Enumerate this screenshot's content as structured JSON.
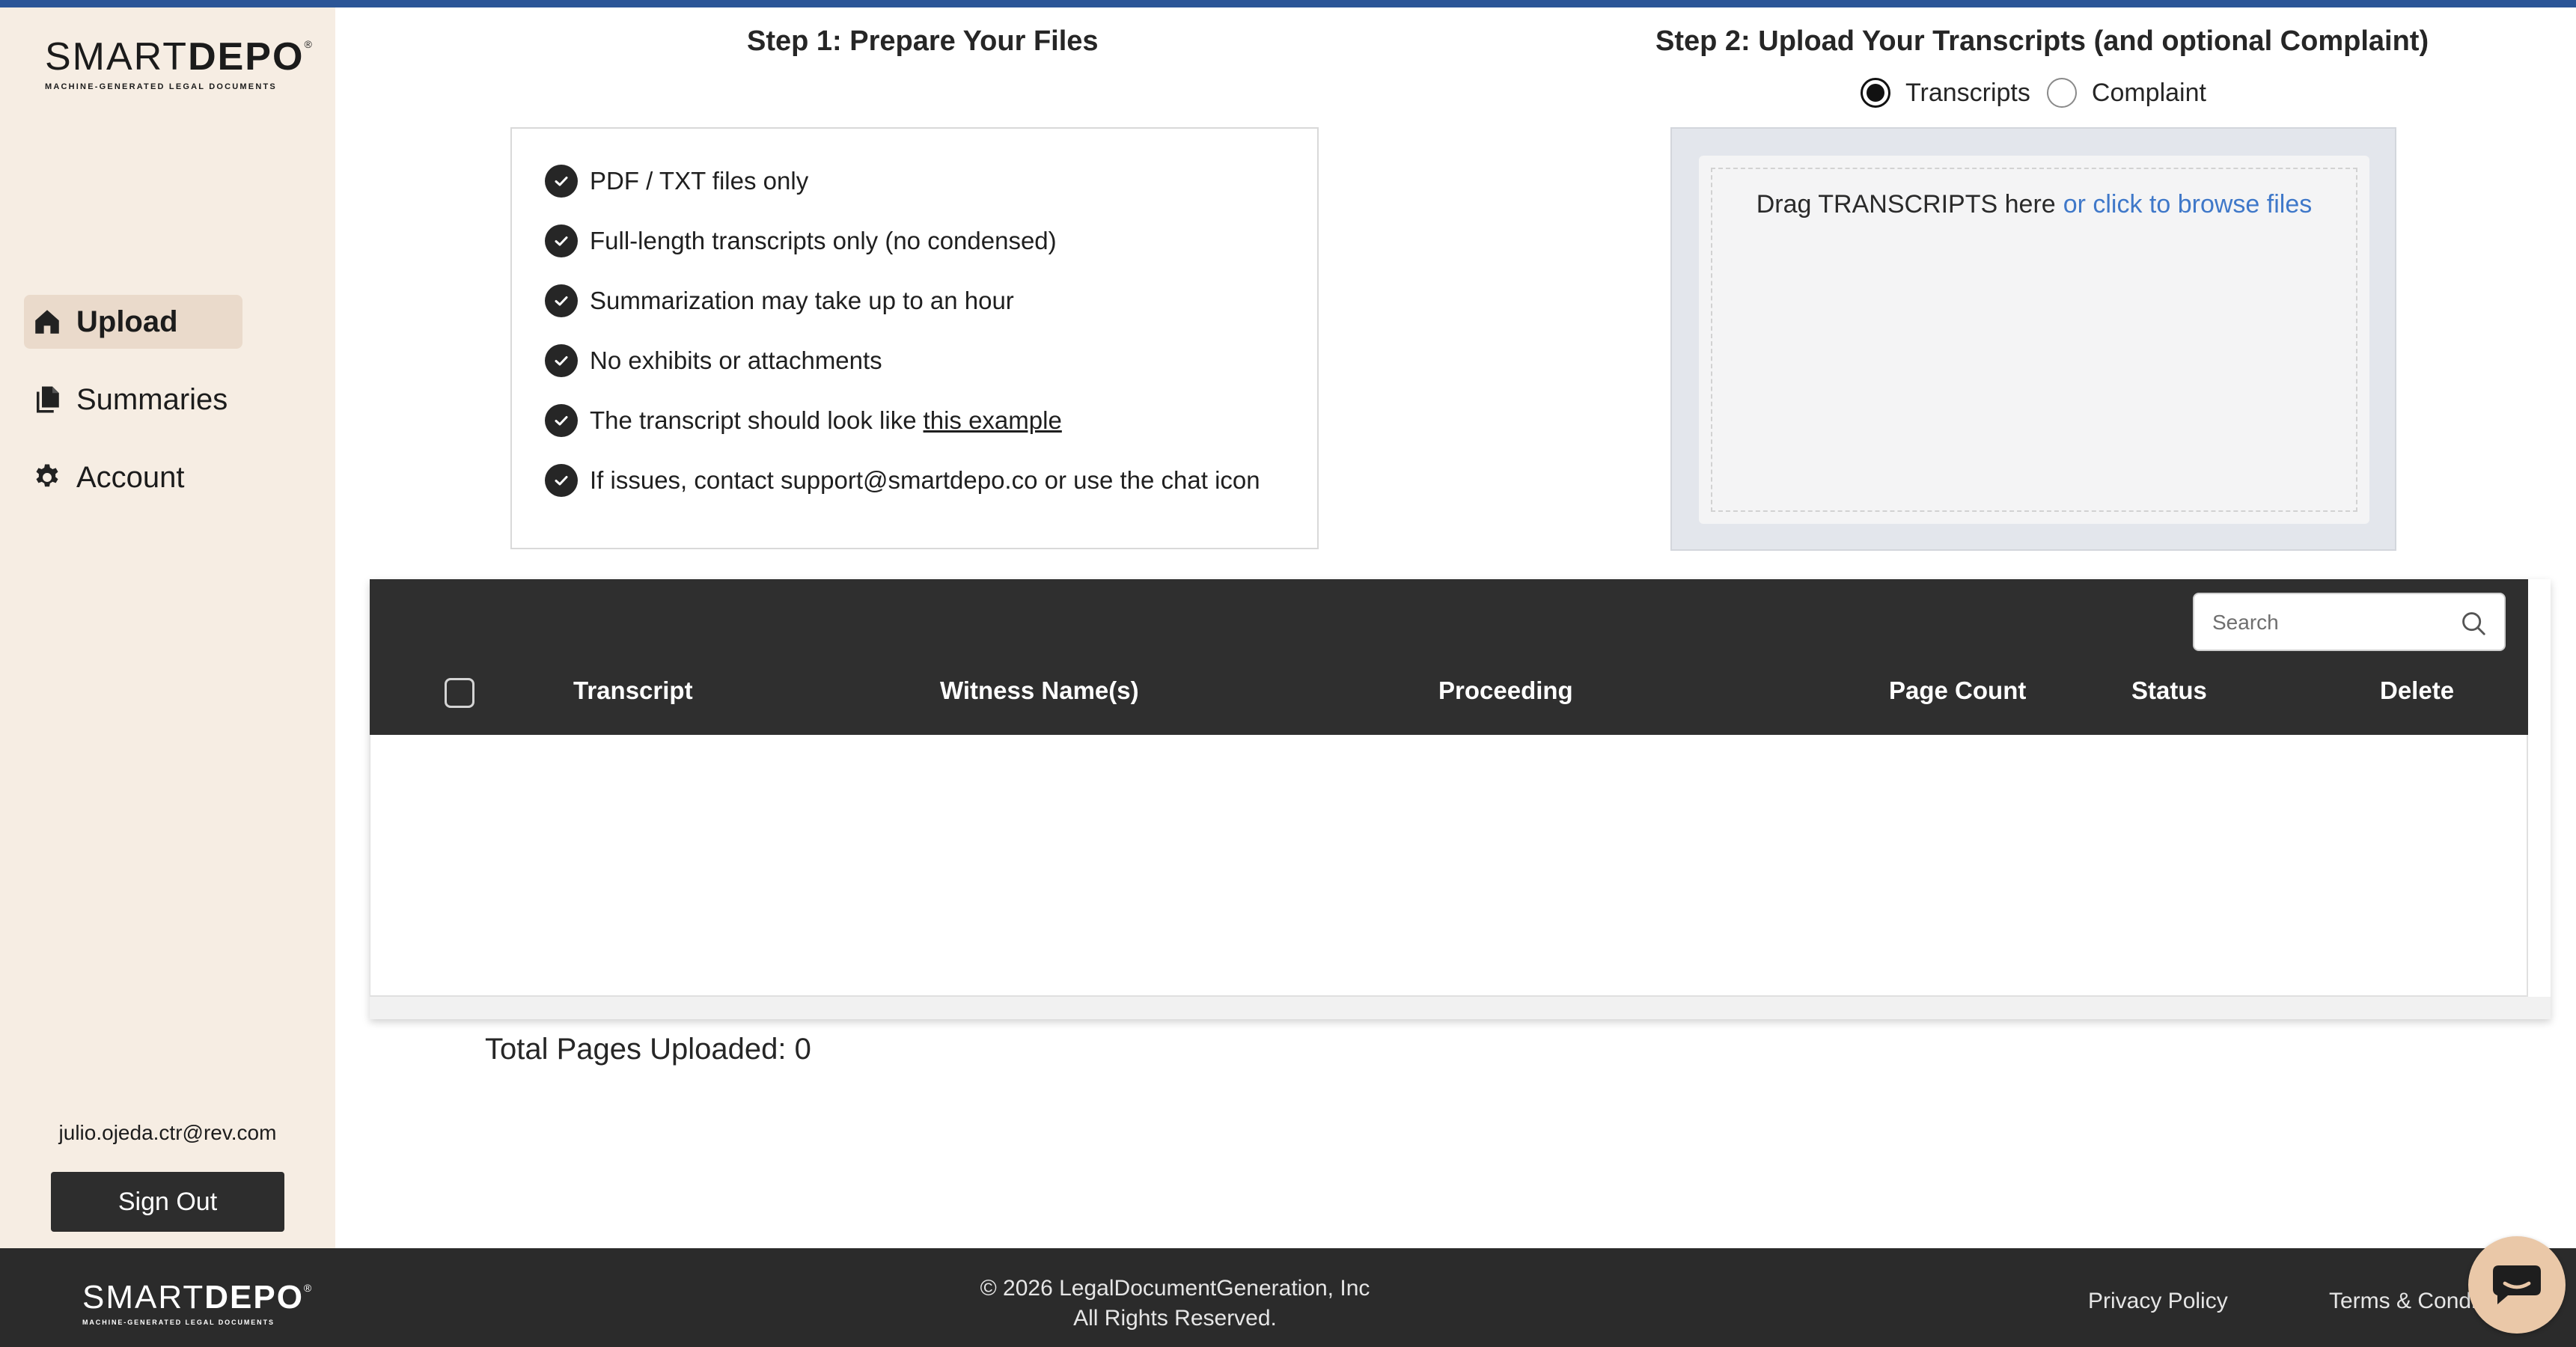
{
  "brand": {
    "logo_light": "SMART",
    "logo_bold": "DEPO",
    "logo_mark": "®",
    "tagline": "MACHINE-GENERATED LEGAL DOCUMENTS"
  },
  "sidebar": {
    "items": [
      {
        "label": "Upload",
        "icon": "home-icon",
        "active": true
      },
      {
        "label": "Summaries",
        "icon": "documents-icon",
        "active": false
      },
      {
        "label": "Account",
        "icon": "gear-icon",
        "active": false
      }
    ],
    "user_email": "julio.ojeda.ctr@rev.com",
    "sign_out_label": "Sign Out"
  },
  "step1": {
    "title": "Step 1: Prepare Your Files",
    "items": [
      "PDF / TXT files only",
      "Full-length transcripts only (no condensed)",
      "Summarization may take up to an hour",
      "No exhibits or attachments",
      "The transcript should look like",
      "If issues, contact support@smartdepo.co or use the chat icon"
    ],
    "example_link": "this example"
  },
  "step2": {
    "title": "Step 2: Upload Your Transcripts (and optional Complaint)",
    "options": [
      {
        "label": "Transcripts",
        "selected": true
      },
      {
        "label": "Complaint",
        "selected": false
      }
    ],
    "drop_text": "Drag TRANSCRIPTS here",
    "browse_text": "or click to browse files"
  },
  "table": {
    "search_placeholder": "Search",
    "columns": [
      "Transcript",
      "Witness Name(s)",
      "Proceeding",
      "Page Count",
      "Status",
      "Delete"
    ],
    "rows": []
  },
  "total_pages": "Total Pages Uploaded: 0",
  "footer": {
    "copyright_line1": "© 2026 LegalDocumentGeneration, Inc",
    "copyright_line2": "All Rights Reserved.",
    "privacy": "Privacy Policy",
    "terms": "Terms & Conditions"
  },
  "colors": {
    "accent_bar": "#2b5597",
    "sidebar_bg": "#f6ede3",
    "active_nav": "#eadacb",
    "link_blue": "#3f78c9",
    "table_header": "#2f2f2f",
    "footer_bg": "#2b2b2b",
    "chat_button": "#eac8a8"
  }
}
